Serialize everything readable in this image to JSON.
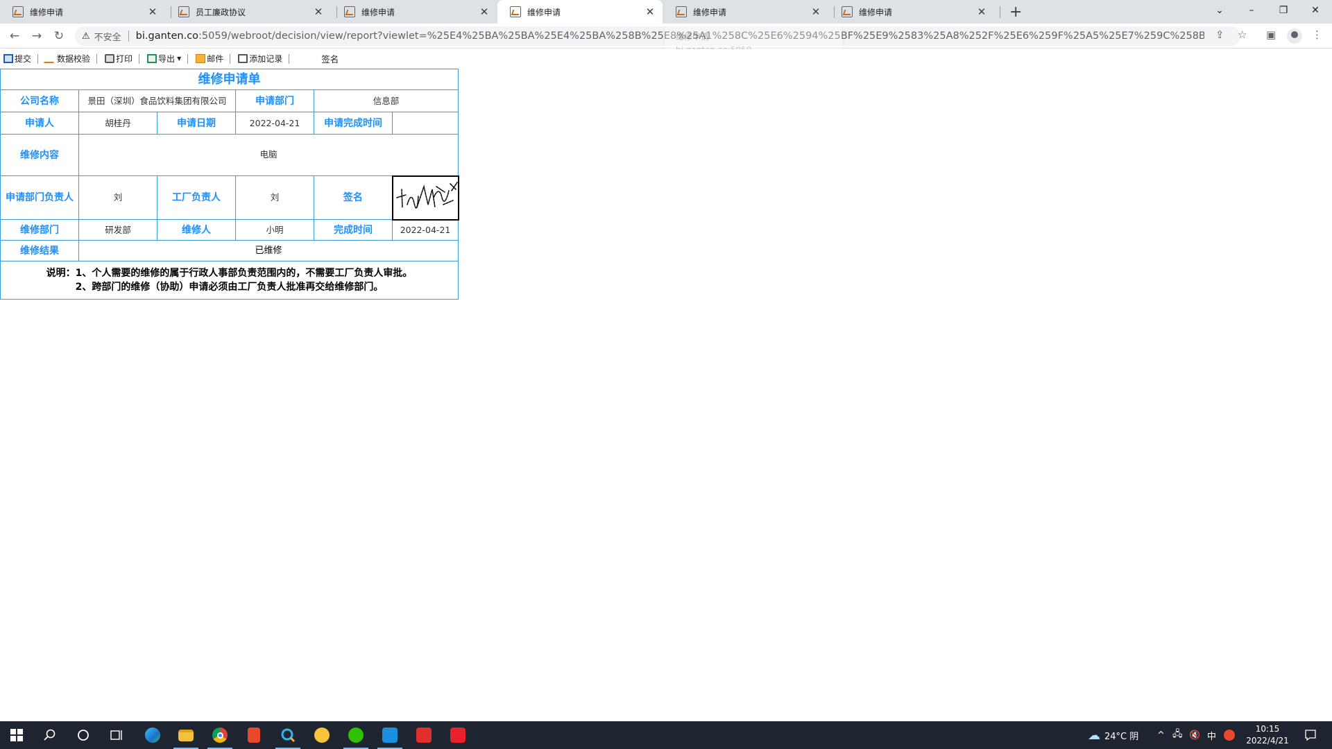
{
  "browser": {
    "tabs": [
      {
        "title": "维修申请",
        "active": false
      },
      {
        "title": "员工廉政协议",
        "active": false
      },
      {
        "title": "维修申请",
        "active": false
      },
      {
        "title": "维修申请",
        "active": true
      },
      {
        "title": "维修申请",
        "active": false
      },
      {
        "title": "维修申请",
        "active": false
      }
    ],
    "security_label": "不安全",
    "url_host": "bi.ganten.co",
    "url_rest": ":5059/webroot/decision/view/report?viewlet=%25E4%25BA%25BA%25E4%25BA%258B%25E8%25A1%258C%25E6%2594%25BF%25E9%2583%25A8%252F%25E6%259F%25A5%25E7%259C%258B%252F%25E7%25B...",
    "hover_card": {
      "title": "维修申请",
      "host": "bi.ganten.co:5059"
    }
  },
  "report_toolbar": {
    "submit": "提交",
    "validate": "数据校验",
    "print": "打印",
    "export": "导出",
    "mail": "邮件",
    "add_record": "添加记录",
    "signature": "签名"
  },
  "form": {
    "title": "维修申请单",
    "company_label": "公司名称",
    "company_value": "景田（深圳）食品饮料集团有限公司",
    "dept_label": "申请部门",
    "dept_value": "信息部",
    "applicant_label": "申请人",
    "applicant_value": "胡桂丹",
    "apply_date_label": "申请日期",
    "apply_date_value": "2022-04-21",
    "due_label": "申请完成时间",
    "due_value": "",
    "content_label": "维修内容",
    "content_value": "电脑",
    "dept_head_label": "申请部门负责人",
    "dept_head_value": "刘",
    "factory_head_label": "工厂负责人",
    "factory_head_value": "刘",
    "sign_label": "签名",
    "repair_dept_label": "维修部门",
    "repair_dept_value": "研发部",
    "repairer_label": "维修人",
    "repairer_value": "小明",
    "finish_label": "完成时间",
    "finish_value": "2022-04-21",
    "result_label": "维修结果",
    "result_value": "已维修",
    "note_line1": "说明：1、个人需要的维修的属于行政人事部负责范围内的，不需要工厂负责人审批。",
    "note_line2": "2、跨部门的维修（协助）申请必须由工厂负责人批准再交给维修部门。"
  },
  "taskbar": {
    "weather": "24°C 阴",
    "ime": "中",
    "time": "10:15",
    "date": "2022/4/21"
  }
}
